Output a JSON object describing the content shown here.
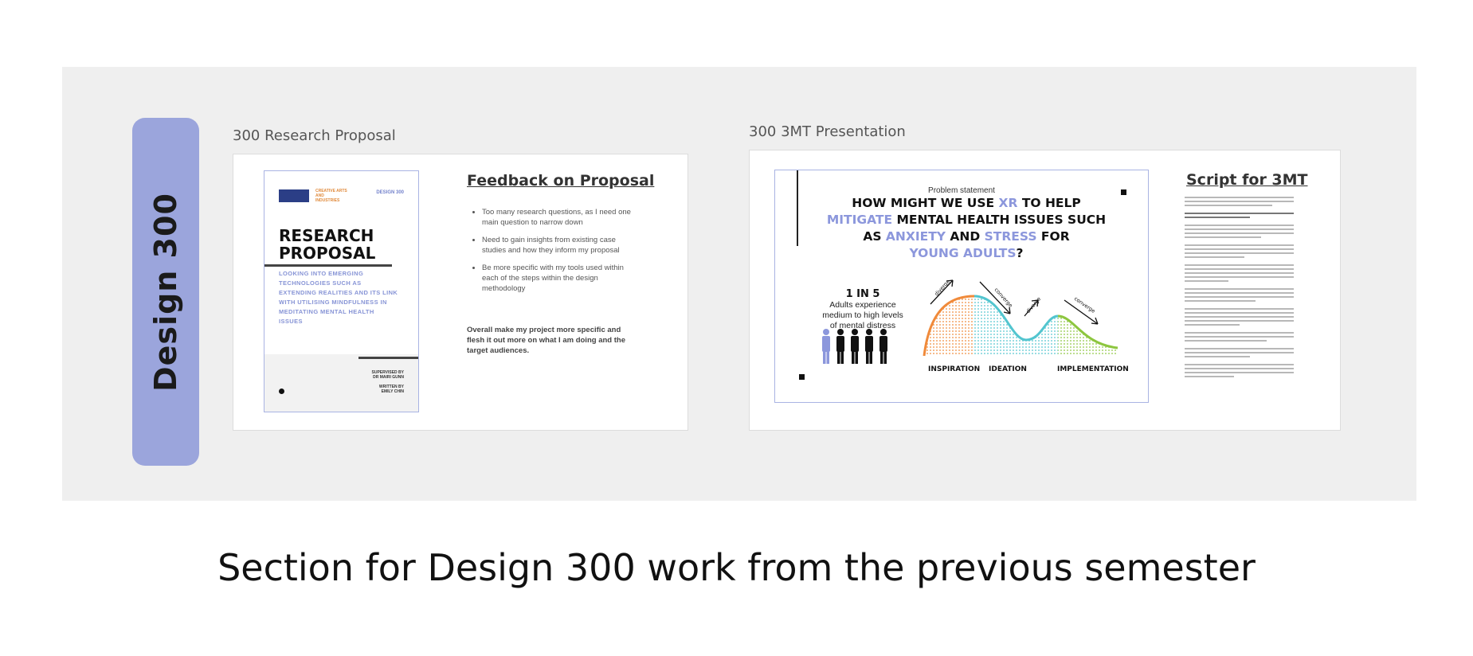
{
  "section_label": "Design 300",
  "caption": "Section for Design 300 work from the previous semester",
  "proposal": {
    "frame_title": "300 Research Proposal",
    "document": {
      "org_label": "CREATIVE ARTS AND INDUSTRIES",
      "code": "DESIGN 300",
      "title_line1": "RESEARCH",
      "title_line2": "PROPOSAL",
      "subtitle": "LOOKING INTO EMERGING TECHNOLOGIES SUCH AS EXTENDING REALITIES AND ITS LINK WITH UTILISING MINDFULNESS IN MEDITATING MENTAL HEALTH ISSUES",
      "supervisor_label": "SUPERVISED BY",
      "supervisor": "DR MAIRI GUNN",
      "author_label": "WRITTEN BY",
      "author": "EMILY CHIN"
    },
    "feedback_heading": "Feedback on Proposal",
    "feedback_items": [
      "Too many research questions, as I need one main question to narrow down",
      "Need to gain insights from existing case studies and how they inform my proposal",
      "Be more specific with my tools used within each of the steps within the design methodology"
    ],
    "summary": "Overall make my project more specific and flesh it out more on what I am doing and the target audiences."
  },
  "presentation": {
    "frame_title": "300 3MT Presentation",
    "problem_label": "Problem statement",
    "question": {
      "p1": "HOW MIGHT WE USE ",
      "h1": "XR",
      "p2": " TO HELP",
      "h2": "MITIGATE",
      "p3": " MENTAL HEALTH ISSUES SUCH AS ",
      "h3": "ANXIETY",
      "p4": " AND ",
      "h4": "STRESS",
      "p5": " FOR",
      "h5": "YOUNG ADULTS",
      "p6": "?"
    },
    "stat_big": "1 IN 5",
    "stat_desc": "Adults experience medium to high levels of mental distress",
    "phases": [
      "INSPIRATION",
      "IDEATION",
      "IMPLEMENTATION"
    ],
    "arrow_labels": [
      "diverge",
      "converge",
      "diverge",
      "converge"
    ],
    "script_heading": "Script for 3MT",
    "colors": {
      "accent": "#8c97dc",
      "inspiration": "#f08a3a",
      "ideation": "#52c5cf",
      "implementation": "#8dc63f",
      "section_label_bg": "#9ba5dc"
    }
  }
}
